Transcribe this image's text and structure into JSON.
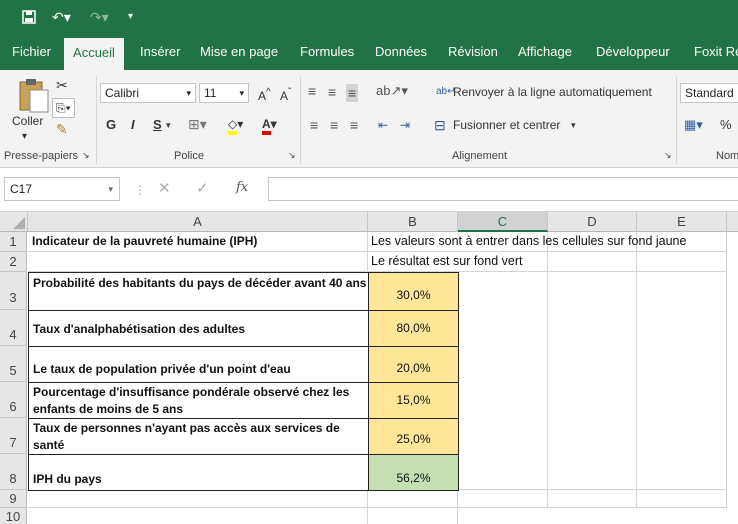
{
  "ribbon_tabs": [
    "Fichier",
    "Accueil",
    "Insérer",
    "Mise en page",
    "Formules",
    "Données",
    "Révision",
    "Affichage",
    "Développeur",
    "Foxit Re"
  ],
  "active_tab": "Accueil",
  "ribbon": {
    "clipboard": {
      "paste_label": "Coller",
      "group_label": "Presse-papiers"
    },
    "font": {
      "name": "Calibri",
      "size": "11",
      "bold": "G",
      "italic": "I",
      "underline": "S",
      "group_label": "Police"
    },
    "alignment": {
      "wrap_text": "Renvoyer à la ligne automatiquement",
      "merge_center": "Fusionner et centrer",
      "group_label": "Alignement"
    },
    "number": {
      "format": "Standard",
      "percent": "%",
      "group_label": "Nom"
    }
  },
  "formula_bar": {
    "name_box": "C17",
    "fx_label": "fx",
    "content": ""
  },
  "columns": [
    "A",
    "B",
    "C",
    "D",
    "E"
  ],
  "selected_column": "C",
  "rows": [
    "1",
    "2",
    "3",
    "4",
    "5",
    "6",
    "7",
    "8",
    "9",
    "10"
  ],
  "cells": {
    "A1": "Indicateur de la pauvreté humaine (IPH)",
    "B1": "Les valeurs sont à entrer dans les cellules sur fond jaune",
    "B2": "Le résultat est sur fond vert",
    "A3": "Probabilité des habitants du pays de décéder avant 40 ans",
    "B3": "30,0%",
    "A4": "Taux d'analphabétisation des adultes",
    "B4": "80,0%",
    "A5": "Le taux de population privée d'un point d'eau",
    "B5": "20,0%",
    "A6": "Pourcentage d'insuffisance pondérale observé chez les enfants de moins de 5 ans",
    "B6": "15,0%",
    "A7": "Taux de personnes n'ayant pas accès aux services de santé",
    "B7": "25,0%",
    "A8": "IPH du pays",
    "B8": "56,2%"
  },
  "colors": {
    "excel_green": "#217346",
    "input_yellow": "#ffe699",
    "result_green": "#c6e0b4"
  }
}
